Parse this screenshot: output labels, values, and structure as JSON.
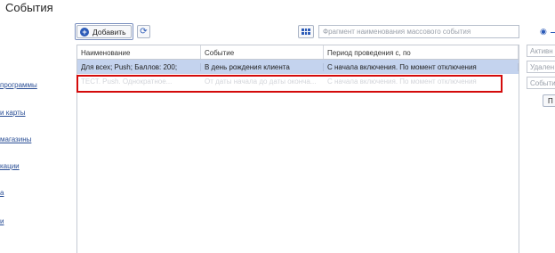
{
  "page": {
    "title": "События"
  },
  "sidebar": {
    "links": [
      "программы",
      "и карты",
      "магазины",
      "кации",
      "а",
      "и"
    ]
  },
  "toolbar": {
    "add_label": "Добавить",
    "search_placeholder": "Фрагмент наименования массового события"
  },
  "table": {
    "columns": [
      "Наименование",
      "Событие",
      "Период проведения с, по"
    ],
    "rows": [
      {
        "name": "Для всех; Push; Баллов: 200;",
        "event": "В день рождения клиента",
        "period": "С начала включения. По момент отключения",
        "state": "selected"
      },
      {
        "name": "ТЕСТ. Push. Однократное...",
        "event": "От даты начала до даты оконча...",
        "period": "С начала включения. По момент отключения",
        "state": "disabled"
      }
    ]
  },
  "filters": {
    "active": "Активн",
    "deleted": "Удален",
    "events": "Событи",
    "button": "П"
  },
  "colors": {
    "accent": "#2c5bb8",
    "selection": "#c4d3ee",
    "highlight": "#d40b0b"
  }
}
